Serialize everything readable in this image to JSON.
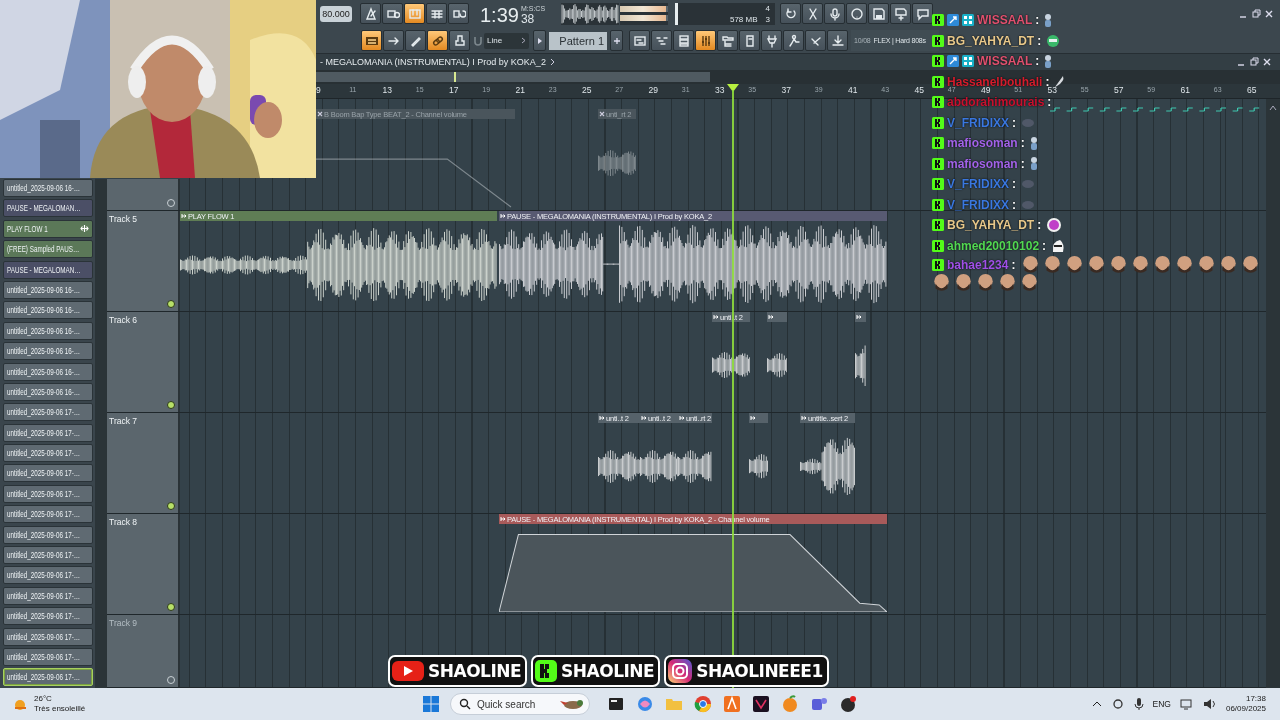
{
  "toolbar": {
    "tempo": "80.000",
    "top_buttons": [
      {
        "on": false
      },
      {
        "on": false
      },
      {
        "on": true
      },
      {
        "on": false
      },
      {
        "on": false
      }
    ],
    "clock": {
      "time": "1:39",
      "centiseconds": "38",
      "format": "M:S:CS"
    },
    "master_meter": {
      "level": 0.95
    },
    "performance": {
      "voices": "4",
      "memory": "578 MB",
      "polyphony": "3"
    },
    "system_buttons": [
      {
        "on": false
      },
      {
        "on": false
      },
      {
        "on": false
      },
      {
        "on": false
      },
      {
        "on": false
      },
      {
        "on": false
      },
      {
        "on": false
      }
    ],
    "mode_buttons": [
      {
        "on": true
      },
      {
        "on": false
      },
      {
        "on": false
      },
      {
        "on": true
      },
      {
        "on": false
      }
    ],
    "snap": "Line",
    "pattern": "Pattern 1",
    "view_buttons": [
      {
        "on": false
      },
      {
        "on": false
      },
      {
        "on": false
      },
      {
        "on": true
      },
      {
        "on": false
      },
      {
        "on": false
      },
      {
        "on": false
      },
      {
        "on": false
      },
      {
        "on": false
      },
      {
        "on": false
      }
    ],
    "hint": {
      "counter": "10/08",
      "text": "FLEX | Hard 808s"
    }
  },
  "playlist": {
    "title": "- MEGALOMANIA (INSTRUMENTAL) I Prod by KOKA_2",
    "ruler": [
      "9",
      "11",
      "13",
      "15",
      "17",
      "19",
      "21",
      "23",
      "25",
      "27",
      "29",
      "31",
      "33",
      "35",
      "37",
      "39",
      "41",
      "43",
      "45",
      "47",
      "49",
      "51",
      "53",
      "55",
      "57",
      "59",
      "61",
      "63",
      "65"
    ]
  },
  "picker": [
    {
      "label": "untitled_2025-09-06 16-…",
      "kind": "audio",
      "color": "#5f6a72",
      "selected": false
    },
    {
      "label": "PAUSE - MEGALOMAN…",
      "kind": "pattern",
      "color": "#4b4f66",
      "selected": false
    },
    {
      "label": "PLAY FLOW 1",
      "kind": "pattern",
      "color": "#5b7858",
      "selected": false
    },
    {
      "label": "(FREE) Sampled PAUS…",
      "kind": "pattern",
      "color": "#5b7858",
      "selected": false
    },
    {
      "label": "PAUSE - MEGALOMAN…",
      "kind": "pattern",
      "color": "#4b4f66",
      "selected": false
    },
    {
      "label": "untitled_2025-09-06 16-…",
      "kind": "audio",
      "color": "#5f6a72",
      "selected": false
    },
    {
      "label": "untitled_2025-09-06 16-…",
      "kind": "audio",
      "color": "#5f6a72",
      "selected": false
    },
    {
      "label": "untitled_2025-09-06 16-…",
      "kind": "audio",
      "color": "#5f6a72",
      "selected": false
    },
    {
      "label": "untitled_2025-09-06 16-…",
      "kind": "audio",
      "color": "#5f6a72",
      "selected": false
    },
    {
      "label": "untitled_2025-09-06 16-…",
      "kind": "audio",
      "color": "#5f6a72",
      "selected": false
    },
    {
      "label": "untitled_2025-09-06 16-…",
      "kind": "audio",
      "color": "#5f6a72",
      "selected": false
    },
    {
      "label": "untitled_2025-09-06 17-…",
      "kind": "audio",
      "color": "#5f6a72",
      "selected": false
    },
    {
      "label": "untitled_2025-09-06 17-…",
      "kind": "audio",
      "color": "#5f6a72",
      "selected": false
    },
    {
      "label": "untitled_2025-09-06 17-…",
      "kind": "audio",
      "color": "#5f6a72",
      "selected": false
    },
    {
      "label": "untitled_2025-09-06 17-…",
      "kind": "audio",
      "color": "#5f6a72",
      "selected": false
    },
    {
      "label": "untitled_2025-09-06 17-…",
      "kind": "audio",
      "color": "#5f6a72",
      "selected": false
    },
    {
      "label": "untitled_2025-09-06 17-…",
      "kind": "audio",
      "color": "#5f6a72",
      "selected": false
    },
    {
      "label": "untitled_2025-09-06 17-…",
      "kind": "audio",
      "color": "#5f6a72",
      "selected": false
    },
    {
      "label": "untitled_2025-09-06 17-…",
      "kind": "audio",
      "color": "#5f6a72",
      "selected": false
    },
    {
      "label": "untitled_2025-09-06 17-…",
      "kind": "audio",
      "color": "#5f6a72",
      "selected": false
    },
    {
      "label": "untitled_2025-09-06 17-…",
      "kind": "audio",
      "color": "#5f6a72",
      "selected": false
    },
    {
      "label": "untitled_2025-09-06 17-…",
      "kind": "audio",
      "color": "#5f6a72",
      "selected": false
    },
    {
      "label": "untitled_2025-09-06 17-…",
      "kind": "audio",
      "color": "#5f6a72",
      "selected": false
    },
    {
      "label": "untitled_2025-09-06 17-…",
      "kind": "audio",
      "color": "#5f6a72",
      "selected": false
    },
    {
      "label": "untitled_2025-09-06 17-…",
      "kind": "audio",
      "color": "#5f6a72",
      "selected": true
    }
  ],
  "tracks": [
    {
      "enabled": false,
      "clips": [
        {
          "label": "B Boom Bap Type BEAT_2 - Channel volume",
          "kind": "automation",
          "color": "#4a555c"
        },
        {
          "label": "unti_rt 2",
          "kind": "audio",
          "color": "#4a555c"
        }
      ]
    },
    {
      "name": "Track 5",
      "enabled": true,
      "clips": [
        {
          "label": "PLAY FLOW 1",
          "kind": "audio",
          "color": "#5f7d55"
        },
        {
          "label": "PAUSE - MEGALOMANIA (INSTRUMENTAL) I Prod by KOKA_2",
          "kind": "audio",
          "color": "#585a72"
        }
      ]
    },
    {
      "name": "Track 6",
      "enabled": true,
      "clips": [
        {
          "label": "unti..t 2",
          "kind": "audio",
          "color": "#56626a"
        },
        {
          "kind": "audio",
          "color": "#56626a"
        },
        {
          "kind": "audio",
          "color": "#56626a"
        }
      ]
    },
    {
      "name": "Track 7",
      "enabled": true,
      "clips": [
        {
          "label": "unti..t 2",
          "kind": "audio",
          "color": "#56626a"
        },
        {
          "label": "unti..t 2",
          "kind": "audio",
          "color": "#56626a"
        },
        {
          "label": "unti..rt 2",
          "kind": "audio",
          "color": "#56626a"
        },
        {
          "kind": "audio",
          "color": "#56626a"
        },
        {
          "label": "untitle..sert 2",
          "kind": "audio",
          "color": "#56626a"
        }
      ]
    },
    {
      "name": "Track 8",
      "enabled": true,
      "clips": [
        {
          "label": "PAUSE - MEGALOMANIA (INSTRUMENTAL) I Prod by KOKA_2 - Channel volume",
          "kind": "automation",
          "color": "#a85a5a"
        }
      ]
    },
    {
      "name": "Track 9",
      "enabled": false
    }
  ],
  "chat": [
    {
      "user": "WISSAAL",
      "colon": ":",
      "color": "#e0506e",
      "moderator": true
    },
    {
      "user": "BG_YAHYA_DT",
      "colon": ":",
      "color": "#e8c88a",
      "moderator": false
    },
    {
      "user": "WISSAAL",
      "colon": ":",
      "color": "#e0506e",
      "moderator": true
    },
    {
      "user": "Hassanelbouhali",
      "colon": ":",
      "color": "#d41c2c",
      "moderator": false
    },
    {
      "user": "abdorahimourais",
      "colon": ":",
      "color": "#c8102e",
      "moderator": false
    },
    {
      "user": "V_FRIDIXX",
      "colon": ":",
      "color": "#3a78e0",
      "moderator": false
    },
    {
      "user": "mafiosoman",
      "colon": ":",
      "color": "#a262e8",
      "moderator": false
    },
    {
      "user": "mafiosoman",
      "colon": ":",
      "color": "#a262e8",
      "moderator": false
    },
    {
      "user": "V_FRIDIXX",
      "colon": ":",
      "color": "#3a78e0",
      "moderator": false
    },
    {
      "user": "V_FRIDIXX",
      "colon": ":",
      "color": "#3a78e0",
      "moderator": false
    },
    {
      "user": "BG_YAHYA_DT",
      "colon": ":",
      "color": "#e8c88a",
      "moderator": false
    },
    {
      "user": "ahmed20010102",
      "colon": ":",
      "color": "#52d852",
      "moderator": false
    },
    {
      "user": "bahae1234",
      "colon": ":",
      "color": "#a050e8",
      "moderator": false
    }
  ],
  "banner": [
    {
      "kind": "youtube",
      "label": "SHAOLINE"
    },
    {
      "kind": "kick",
      "label": "SHAOLINE"
    },
    {
      "kind": "instagram",
      "label": "SHAOLINEEE1"
    }
  ],
  "taskbar": {
    "weather": {
      "temperature": "26°C",
      "condition": "Très ensoleillé"
    },
    "search": {
      "placeholder": "Quick search"
    },
    "language": "ENG",
    "time": "17:38",
    "date": "06/09/2025"
  }
}
